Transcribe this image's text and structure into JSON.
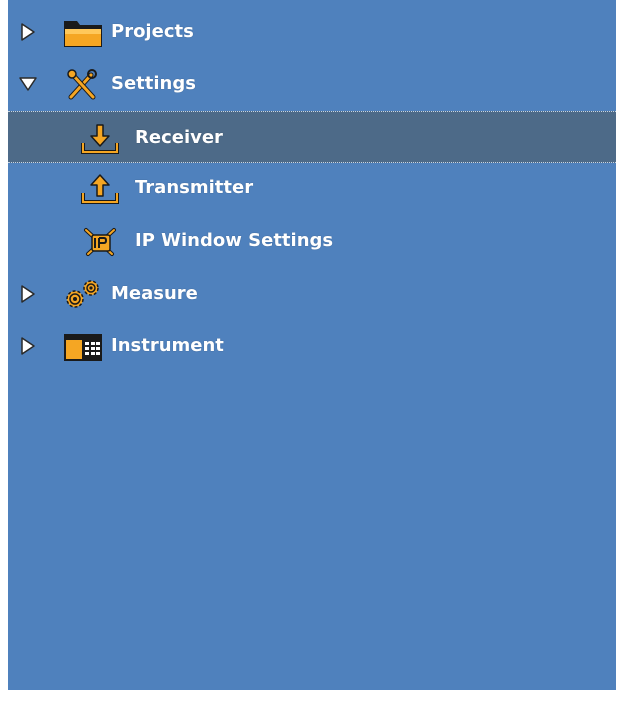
{
  "tree": {
    "items": [
      {
        "label": "Projects",
        "icon": "folder-icon",
        "expander": "collapsed"
      },
      {
        "label": "Settings",
        "icon": "tools-icon",
        "expander": "expanded"
      },
      {
        "label": "Receiver",
        "icon": "download-tray-icon",
        "selected": true
      },
      {
        "label": "Transmitter",
        "icon": "upload-tray-icon"
      },
      {
        "label": "IP Window Settings",
        "icon": "ip-settings-icon"
      },
      {
        "label": "Measure",
        "icon": "gears-icon",
        "expander": "collapsed"
      },
      {
        "label": "Instrument",
        "icon": "instrument-window-icon",
        "expander": "collapsed"
      }
    ]
  },
  "colors": {
    "panel_background": "#4f81bd",
    "selected_row": "#4d6a88",
    "icon_orange": "#f5a623",
    "text": "#ffffff"
  }
}
